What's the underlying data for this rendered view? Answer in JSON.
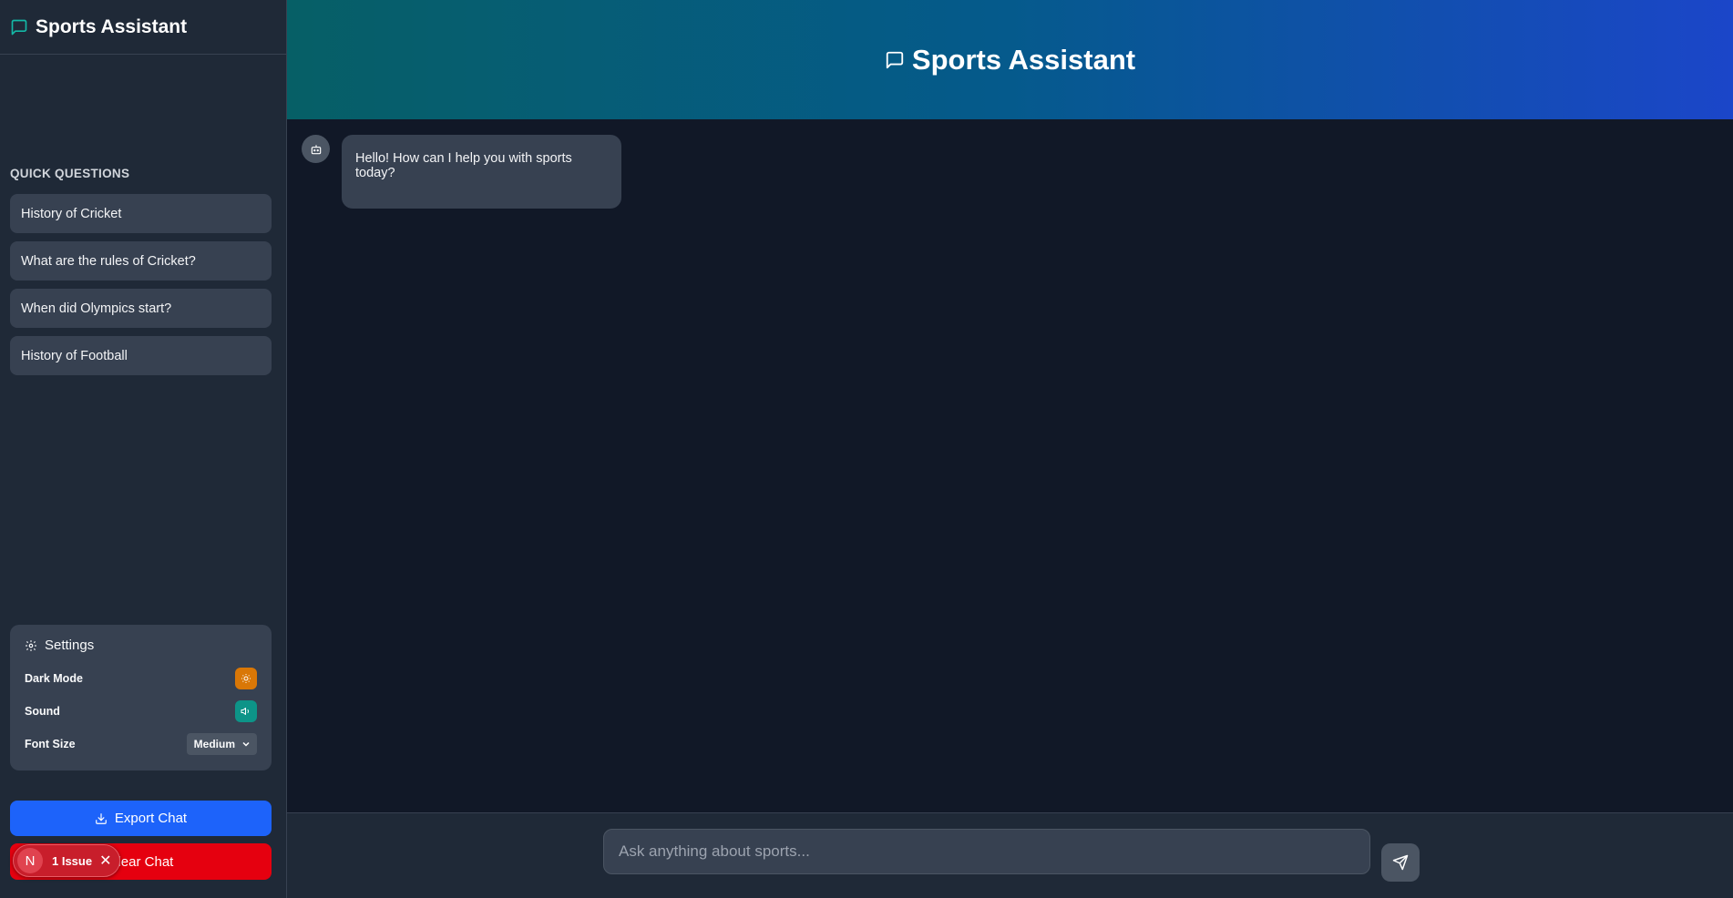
{
  "sidebar": {
    "title": "Sports Assistant",
    "quick_questions_label": "QUICK QUESTIONS",
    "quick_questions": [
      "History of Cricket",
      "What are the rules of Cricket?",
      "When did Olympics start?",
      "History of Football"
    ],
    "settings": {
      "title": "Settings",
      "dark_mode_label": "Dark Mode",
      "sound_label": "Sound",
      "font_size_label": "Font Size",
      "font_size_value": "Medium"
    },
    "export_label": "Export Chat",
    "clear_label": "Clear Chat",
    "issue_badge": {
      "letter": "N",
      "text": "1 Issue"
    }
  },
  "main": {
    "title": "Sports Assistant",
    "messages": [
      {
        "sender": "bot",
        "text": "Hello! How can I help you with sports today?"
      }
    ],
    "input": {
      "placeholder": "Ask anything about sports...",
      "value": ""
    }
  },
  "colors": {
    "accent_teal": "#14b8a6",
    "export_blue": "#1d63fa",
    "clear_red": "#e5000f",
    "dark_mode_toggle": "#d97706",
    "sound_toggle": "#0d9488"
  },
  "icons": {
    "logo": "message-square-icon",
    "settings": "gear-icon",
    "dark_mode": "sun-icon",
    "sound": "speaker-icon",
    "export": "download-icon",
    "bot": "robot-icon",
    "send": "send-icon"
  }
}
